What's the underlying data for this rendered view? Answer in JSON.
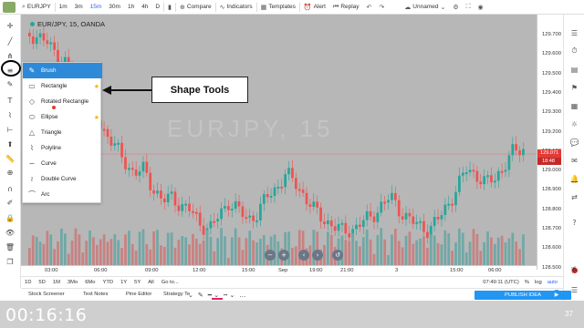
{
  "topbar": {
    "symbol": "EURJPY",
    "timeframes": [
      "1m",
      "3m",
      "15m",
      "30m",
      "1h",
      "4h",
      "D"
    ],
    "active_timeframe": "15m",
    "compare": "Compare",
    "indicators": "Indicators",
    "templates": "Templates",
    "alert": "Alert",
    "replay": "Replay",
    "layout": "Unnamed"
  },
  "chart": {
    "title": "EUR/JPY, 15, OANDA",
    "watermark": "EURJPY, 15",
    "current_price": "129.071",
    "timer": "18:48",
    "price_labels": [
      "129.700",
      "129.600",
      "129.500",
      "129.400",
      "129.300",
      "129.200",
      "129.100",
      "129.000",
      "128.900",
      "128.800",
      "128.700",
      "128.600",
      "128.500"
    ],
    "time_labels": [
      "03:00",
      "06:00",
      "09:00",
      "12:00",
      "15:00",
      "Sep",
      "19:00",
      "21:00",
      "3",
      "15:00",
      "06:00"
    ],
    "colors": {
      "up": "#26a69a",
      "down": "#ef5350",
      "background": "#b7b7b7"
    }
  },
  "shape_menu": {
    "items": [
      {
        "label": "Brush",
        "icon": "brush-icon",
        "starred": false,
        "active": true
      },
      {
        "label": "Rectangle",
        "icon": "rectangle-icon",
        "starred": true,
        "active": false
      },
      {
        "label": "Rotated Rectangle",
        "icon": "rotated-rectangle-icon",
        "starred": false,
        "active": false
      },
      {
        "label": "Ellipse",
        "icon": "ellipse-icon",
        "starred": true,
        "active": false
      },
      {
        "label": "Triangle",
        "icon": "triangle-icon",
        "starred": false,
        "active": false
      },
      {
        "label": "Polyline",
        "icon": "polyline-icon",
        "starred": false,
        "active": false
      },
      {
        "label": "Curve",
        "icon": "curve-icon",
        "starred": false,
        "active": false
      },
      {
        "label": "Double Curve",
        "icon": "double-curve-icon",
        "starred": false,
        "active": false
      },
      {
        "label": "Arc",
        "icon": "arc-icon",
        "starred": false,
        "active": false
      }
    ]
  },
  "callout": {
    "text": "Shape Tools"
  },
  "rangebar": {
    "ranges": [
      "1D",
      "5D",
      "1M",
      "3Mo",
      "6Mo",
      "YTD",
      "1Y",
      "5Y",
      "All",
      "Go to..."
    ],
    "clock": "07:49:11 (UTC)",
    "percent": "%",
    "log": "log",
    "auto": "auto"
  },
  "bottombar": {
    "tabs": [
      "Stock Screener",
      "Text Notes",
      "Pine Editor",
      "Strategy Te"
    ],
    "publish": "PUBLISH IDEA"
  },
  "video": {
    "time": "00:16:16",
    "number": "37"
  }
}
